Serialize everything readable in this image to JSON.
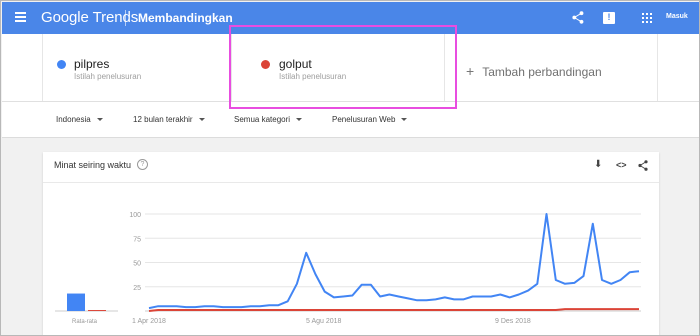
{
  "header": {
    "brand": "Google Trends",
    "page_title": "Membandingkan",
    "feedback_glyph": "!",
    "signin_label": "Masuk",
    "accent_color": "#4a86e8"
  },
  "compare": {
    "terms": [
      {
        "label": "pilpres",
        "sublabel": "Istilah penelusuran",
        "color": "#4285f4"
      },
      {
        "label": "golput",
        "sublabel": "Istilah penelusuran",
        "color": "#db4437"
      }
    ],
    "add_label": "Tambah perbandingan",
    "add_glyph": "+"
  },
  "filters": {
    "region": "Indonesia",
    "period": "12 bulan terakhir",
    "category": "Semua kategori",
    "search_type": "Penelusuran Web"
  },
  "card": {
    "title": "Minat seiring waktu",
    "help_glyph": "?",
    "download_glyph": "⬇",
    "embed_glyph": "<>",
    "share_glyph": "⋖"
  },
  "chart_data": {
    "type": "line",
    "y_ticks": [
      "100",
      "75",
      "50",
      "25"
    ],
    "ylim": [
      0,
      100
    ],
    "x_tick_labels": [
      "1 Apr 2018",
      "5 Agu 2018",
      "9 Des 2018"
    ],
    "average_label": "Rata-rata",
    "average": {
      "pilpres": 18,
      "golput": 1
    },
    "series": [
      {
        "name": "pilpres",
        "color": "#4285f4",
        "values": [
          3,
          5,
          5,
          5,
          4,
          4,
          5,
          5,
          4,
          4,
          4,
          5,
          5,
          6,
          6,
          10,
          28,
          60,
          38,
          20,
          14,
          15,
          16,
          27,
          27,
          15,
          17,
          15,
          13,
          11,
          11,
          12,
          14,
          12,
          12,
          15,
          15,
          15,
          17,
          14,
          17,
          21,
          28,
          100,
          32,
          28,
          29,
          36,
          90,
          32,
          28,
          32,
          40,
          41
        ]
      },
      {
        "name": "golput",
        "color": "#db4437",
        "values": [
          0,
          1,
          1,
          1,
          1,
          1,
          1,
          1,
          1,
          1,
          1,
          1,
          1,
          1,
          1,
          1,
          1,
          1,
          1,
          1,
          1,
          1,
          1,
          1,
          1,
          1,
          1,
          1,
          1,
          1,
          1,
          1,
          1,
          1,
          1,
          1,
          1,
          1,
          1,
          1,
          1,
          1,
          1,
          1,
          1,
          2,
          2,
          2,
          2,
          2,
          2,
          2,
          2,
          2
        ]
      }
    ]
  }
}
